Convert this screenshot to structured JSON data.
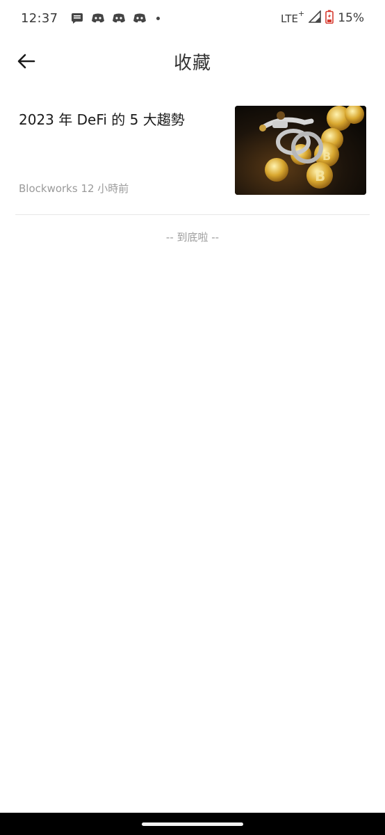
{
  "status_bar": {
    "time": "12:37",
    "network": "LTE",
    "network_plus": "+",
    "battery": "15%",
    "notification_icons": [
      "message-icon",
      "discord-icon",
      "discord-icon",
      "discord-icon"
    ]
  },
  "header": {
    "title": "收藏",
    "back_icon": "arrow-left-icon"
  },
  "articles": [
    {
      "title": "2023 年 DeFi 的 5 大趨勢",
      "meta": "Blockworks 12 小時前",
      "thumbnail": "bitcoin-handcuffs-image"
    }
  ],
  "end_of_list": "-- 到底啦 --"
}
